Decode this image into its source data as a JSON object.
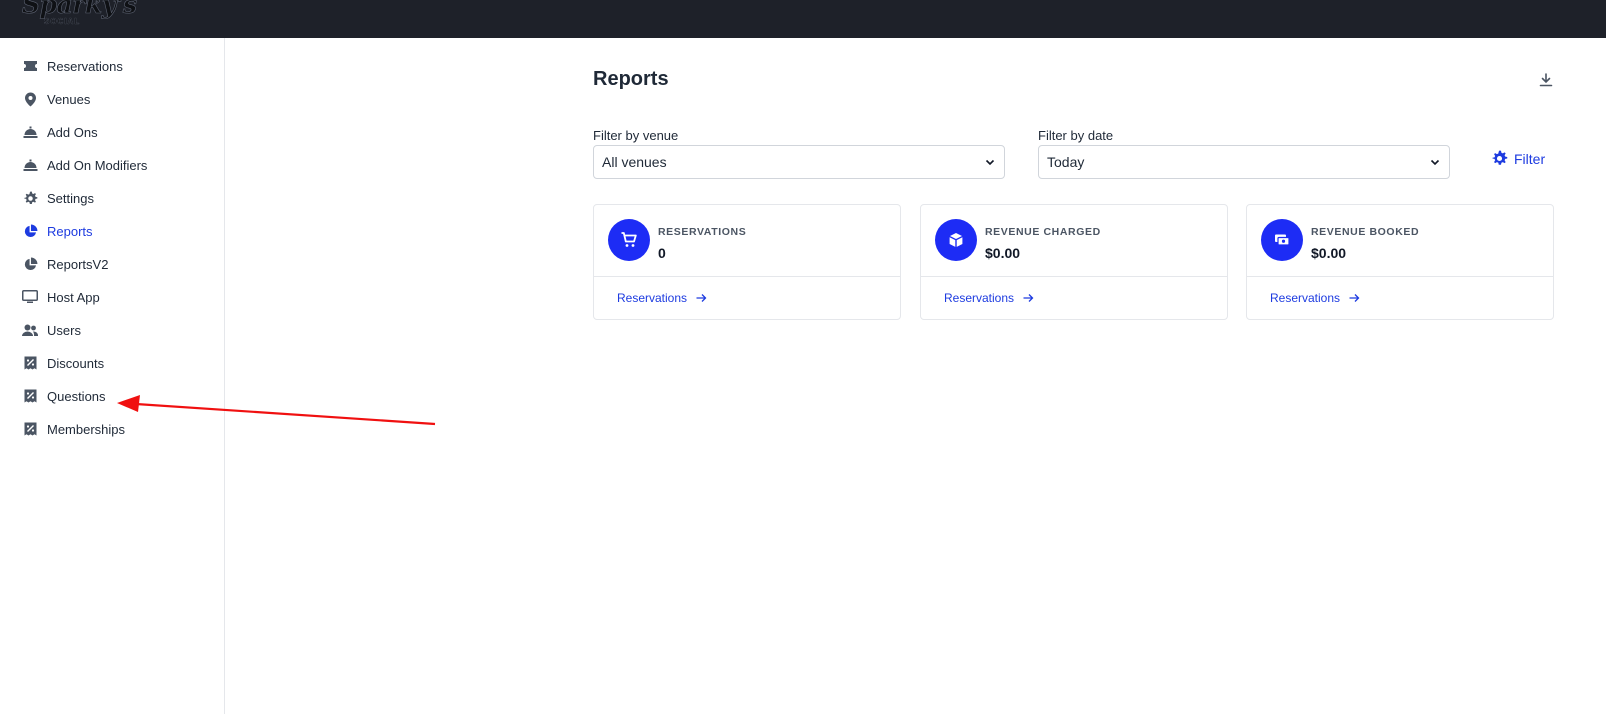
{
  "app": {
    "logo_text": "Sparky's",
    "logo_sub": "SOCIAL"
  },
  "sidebar": {
    "items": [
      {
        "label": "Reservations",
        "icon": "ticket-icon"
      },
      {
        "label": "Venues",
        "icon": "map-pin-icon"
      },
      {
        "label": "Add Ons",
        "icon": "cloche-icon"
      },
      {
        "label": "Add On Modifiers",
        "icon": "cloche-icon"
      },
      {
        "label": "Settings",
        "icon": "gear-icon"
      },
      {
        "label": "Reports",
        "icon": "pie-chart-icon",
        "active": true
      },
      {
        "label": "ReportsV2",
        "icon": "pie-chart-icon"
      },
      {
        "label": "Host App",
        "icon": "monitor-icon"
      },
      {
        "label": "Users",
        "icon": "users-icon"
      },
      {
        "label": "Discounts",
        "icon": "discount-tag-icon"
      },
      {
        "label": "Questions",
        "icon": "discount-tag-icon"
      },
      {
        "label": "Memberships",
        "icon": "discount-tag-icon"
      }
    ]
  },
  "main": {
    "title": "Reports",
    "filters": {
      "venue_label": "Filter by venue",
      "venue_value": "All venues",
      "date_label": "Filter by date",
      "date_value": "Today",
      "filter_button": "Filter"
    },
    "cards": [
      {
        "title": "RESERVATIONS",
        "value": "0",
        "link": "Reservations",
        "icon": "cart-icon"
      },
      {
        "title": "REVENUE CHARGED",
        "value": "$0.00",
        "link": "Reservations",
        "icon": "cube-icon"
      },
      {
        "title": "REVENUE BOOKED",
        "value": "$0.00",
        "link": "Reservations",
        "icon": "cash-icon"
      }
    ]
  },
  "colors": {
    "accent": "#1d3be0",
    "topbar": "#1e2129",
    "icon_circle": "#1d2cf5",
    "annotation_arrow": "#f01010"
  }
}
